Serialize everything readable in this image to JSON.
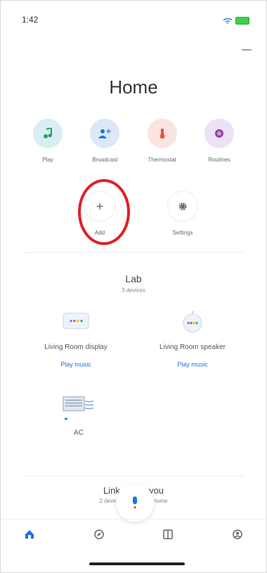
{
  "status": {
    "time": "1:42"
  },
  "header": {
    "title": "Home"
  },
  "actions": [
    {
      "label": "Play",
      "icon": "music-note-icon",
      "bg": "#d9eef2",
      "fg": "#1ea362"
    },
    {
      "label": "Broadcast",
      "icon": "broadcast-people-icon",
      "bg": "#dde8f7",
      "fg": "#1a73e8"
    },
    {
      "label": "Thermostat",
      "icon": "thermostat-icon",
      "bg": "#fbe3df",
      "fg": "#e0573e"
    },
    {
      "label": "Routines",
      "icon": "routines-icon",
      "bg": "#eee1f5",
      "fg": "#8e44ad"
    }
  ],
  "secondary_actions": [
    {
      "label": "Add",
      "icon": "plus-icon"
    },
    {
      "label": "Settings",
      "icon": "gear-icon"
    }
  ],
  "room": {
    "name": "Lab",
    "count": "3 devices"
  },
  "devices": [
    {
      "name": "Living Room display",
      "action": "Play music",
      "icon": "display-icon"
    },
    {
      "name": "Living Room speaker",
      "action": "Play music",
      "icon": "speaker-icon"
    },
    {
      "name": "AC",
      "icon": "ac-icon"
    }
  ],
  "linked": {
    "title_a": "Link",
    "title_b": "you",
    "subtitle": "2 devices · Linked to Home"
  },
  "bottom_nav": [
    {
      "icon": "home-tab-icon",
      "active": true
    },
    {
      "icon": "discover-tab-icon"
    },
    {
      "icon": "media-tab-icon"
    },
    {
      "icon": "account-tab-icon"
    }
  ],
  "colors": {
    "accent": "#1a73e8",
    "highlight_ring": "#e02028"
  }
}
